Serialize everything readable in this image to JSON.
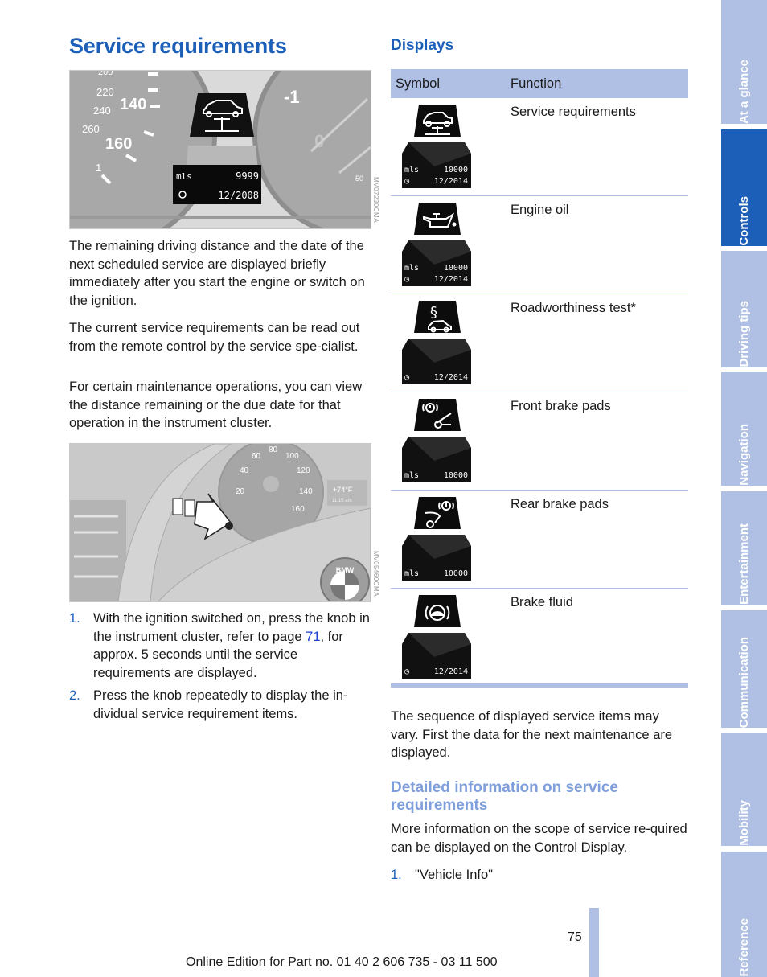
{
  "page_title": "Service requirements",
  "figure1": {
    "code": "MV07230CMA",
    "gauge_labels": [
      "200",
      "220",
      "240",
      "260",
      "140",
      "160",
      "1",
      "-1",
      "0",
      "50"
    ],
    "display_unit": "mls",
    "display_distance": "9999",
    "display_date": "12/2008"
  },
  "paragraphs": [
    "The remaining driving distance and the date of the next scheduled service are displayed briefly immediately after you start the engine or switch on the ignition.",
    "The current service requirements can be read out from the remote control by the service spe-cialist.",
    "For certain maintenance operations, you can view the distance remaining or the due date for that operation in the instrument cluster."
  ],
  "figure2": {
    "code": "MV05460CMA",
    "gauge_labels": [
      "20",
      "40",
      "60",
      "80",
      "100",
      "120",
      "140",
      "160"
    ],
    "temp_readout": "+74°F",
    "clock_readout": "11:15 am",
    "logo_letters": "BMW"
  },
  "steps_left": [
    {
      "num": "1.",
      "pre": "With the ignition switched on, press the knob in the instrument cluster, refer to page ",
      "link": "71",
      "post": ", for approx. 5 seconds until the service requirements are displayed."
    },
    {
      "num": "2.",
      "text": "Press the knob repeatedly to display the in-dividual service requirement items."
    }
  ],
  "displays": {
    "heading": "Displays",
    "columns": [
      "Symbol",
      "Function"
    ],
    "rows": [
      {
        "function": "Service requirements",
        "icon": "car-on-lift-icon",
        "unit": "mls",
        "distance": "10000",
        "date": "12/2014"
      },
      {
        "function": "Engine oil",
        "icon": "oil-can-icon",
        "unit": "mls",
        "distance": "10000",
        "date": "12/2014"
      },
      {
        "function": "Roadworthiness test*",
        "icon": "paragraph-car-icon",
        "unit": "",
        "distance": "",
        "date": "12/2014"
      },
      {
        "function": "Front brake pads",
        "icon": "front-brake-pads-icon",
        "unit": "mls",
        "distance": "10000",
        "date": ""
      },
      {
        "function": "Rear brake pads",
        "icon": "rear-brake-pads-icon",
        "unit": "mls",
        "distance": "10000",
        "date": ""
      },
      {
        "function": "Brake fluid",
        "icon": "brake-fluid-icon",
        "unit": "",
        "distance": "",
        "date": "12/2014"
      }
    ]
  },
  "sequence_note": "The sequence of displayed service items may vary. First the data for the next maintenance are displayed.",
  "detailed": {
    "heading": "Detailed information on service requirements",
    "text": "More information on the scope of service re-quired can be displayed on the Control Display.",
    "steps": [
      {
        "num": "1.",
        "text": "\"Vehicle Info\""
      }
    ]
  },
  "sidebar": {
    "tabs": [
      {
        "label": "At a glance",
        "active": false
      },
      {
        "label": "Controls",
        "active": true
      },
      {
        "label": "Driving tips",
        "active": false
      },
      {
        "label": "Navigation",
        "active": false
      },
      {
        "label": "Entertainment",
        "active": false
      },
      {
        "label": "Communication",
        "active": false
      },
      {
        "label": "Mobility",
        "active": false
      },
      {
        "label": "Reference",
        "active": false
      }
    ]
  },
  "footer": {
    "page_number": "75",
    "edition": "Online Edition for Part no. 01 40 2 606 735 - 03 11 500"
  },
  "colors": {
    "accent": "#1c5fb8",
    "tab_inactive": "#b0c0e4",
    "subheading": "#7f9fdc"
  }
}
